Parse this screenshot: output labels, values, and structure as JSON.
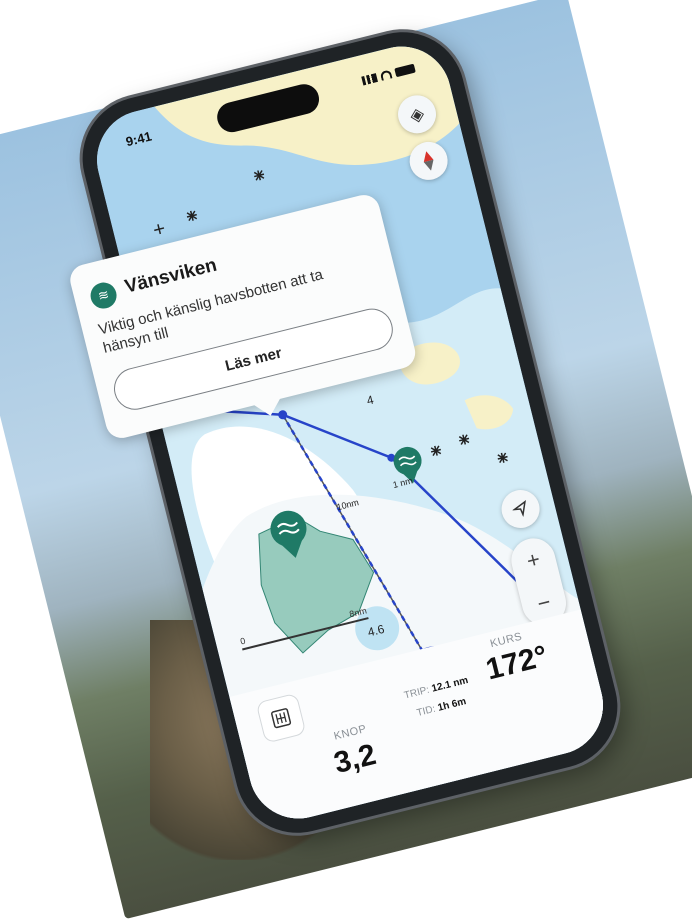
{
  "status_bar": {
    "time": "9:41"
  },
  "popup": {
    "title": "Vänsviken",
    "description": "Viktig och känslig havsbotten att ta hänsyn till",
    "button_label": "Läs mer"
  },
  "map": {
    "depth_labels": [
      "4",
      "4.6"
    ],
    "distance_labels": [
      "10nm",
      "1 nm"
    ],
    "scale_start": "0",
    "scale_end": "8nm"
  },
  "controls": {
    "layers_icon": "layers-icon",
    "compass_icon": "compass-icon",
    "locate_icon": "navigate-arrow-icon",
    "zoom_in": "+",
    "zoom_out": "−"
  },
  "bottom_panel": {
    "knop_label": "KNOP",
    "knop_value": "3,2",
    "trip_label": "TRIP:",
    "trip_value": "12.1 nm",
    "tid_label": "TID:",
    "tid_value": "1h 6m",
    "kurs_label": "KURS",
    "kurs_value": "172°"
  },
  "colors": {
    "water": "#a9d3ee",
    "shallow_water": "#d3ecf7",
    "land": "#f7f1c8",
    "protected_area": "#1f7a66",
    "route": "#2744c9"
  }
}
